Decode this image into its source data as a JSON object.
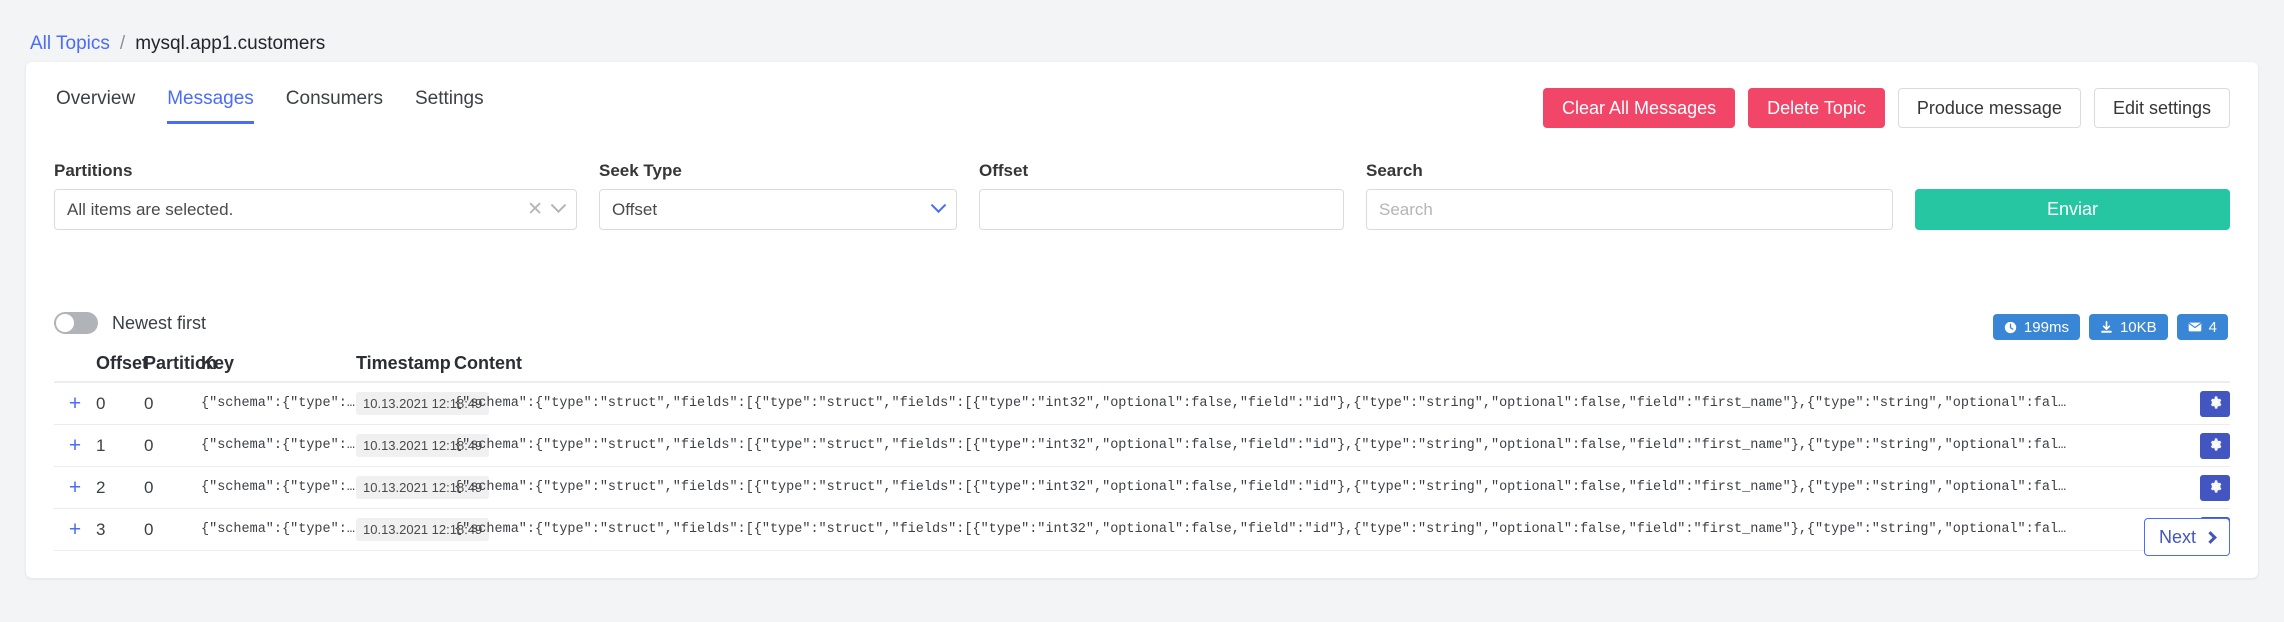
{
  "breadcrumb": {
    "root_label": "All Topics",
    "separator": "/",
    "current_label": "mysql.app1.customers"
  },
  "tabs": [
    {
      "label": "Overview",
      "active": false
    },
    {
      "label": "Messages",
      "active": true
    },
    {
      "label": "Consumers",
      "active": false
    },
    {
      "label": "Settings",
      "active": false
    }
  ],
  "actions": [
    {
      "label": "Clear All Messages",
      "style": "danger"
    },
    {
      "label": "Delete Topic",
      "style": "danger"
    },
    {
      "label": "Produce message",
      "style": "light"
    },
    {
      "label": "Edit settings",
      "style": "light"
    }
  ],
  "filters": {
    "partitions": {
      "label": "Partitions",
      "value": "All items are selected.",
      "clear_icon": "close-icon",
      "chevron_icon": "chevron-down-icon"
    },
    "seek_type": {
      "label": "Seek Type",
      "value": "Offset",
      "chevron_icon": "chevron-down-icon"
    },
    "offset": {
      "label": "Offset",
      "value": "",
      "placeholder": ""
    },
    "search": {
      "label": "Search",
      "value": "",
      "placeholder": "Search"
    },
    "submit_label": "Enviar"
  },
  "sort_toggle": {
    "label": "Newest first",
    "enabled": false
  },
  "badges": [
    {
      "icon": "clock-icon",
      "label": "199ms"
    },
    {
      "icon": "download-icon",
      "label": "10KB"
    },
    {
      "icon": "envelope-icon",
      "label": "4"
    }
  ],
  "table": {
    "columns": [
      "Offset",
      "Partition",
      "Key",
      "Timestamp",
      "Content"
    ],
    "rows": [
      {
        "expand_icon": "plus-icon",
        "offset": "0",
        "partition": "0",
        "key": "{\"schema\":{\"type\":\"struct…",
        "timestamp": "10.13.2021 12:18:49",
        "content": "{\"schema\":{\"type\":\"struct\",\"fields\":[{\"type\":\"struct\",\"fields\":[{\"type\":\"int32\",\"optional\":false,\"field\":\"id\"},{\"type\":\"string\",\"optional\":false,\"field\":\"first_name\"},{\"type\":\"string\",\"optional\":fal…",
        "action_icon": "gear-icon"
      },
      {
        "expand_icon": "plus-icon",
        "offset": "1",
        "partition": "0",
        "key": "{\"schema\":{\"type\":\"struct…",
        "timestamp": "10.13.2021 12:18:49",
        "content": "{\"schema\":{\"type\":\"struct\",\"fields\":[{\"type\":\"struct\",\"fields\":[{\"type\":\"int32\",\"optional\":false,\"field\":\"id\"},{\"type\":\"string\",\"optional\":false,\"field\":\"first_name\"},{\"type\":\"string\",\"optional\":fal…",
        "action_icon": "gear-icon"
      },
      {
        "expand_icon": "plus-icon",
        "offset": "2",
        "partition": "0",
        "key": "{\"schema\":{\"type\":\"struct…",
        "timestamp": "10.13.2021 12:18:49",
        "content": "{\"schema\":{\"type\":\"struct\",\"fields\":[{\"type\":\"struct\",\"fields\":[{\"type\":\"int32\",\"optional\":false,\"field\":\"id\"},{\"type\":\"string\",\"optional\":false,\"field\":\"first_name\"},{\"type\":\"string\",\"optional\":fal…",
        "action_icon": "gear-icon"
      },
      {
        "expand_icon": "plus-icon",
        "offset": "3",
        "partition": "0",
        "key": "{\"schema\":{\"type\":\"struct…",
        "timestamp": "10.13.2021 12:18:49",
        "content": "{\"schema\":{\"type\":\"struct\",\"fields\":[{\"type\":\"struct\",\"fields\":[{\"type\":\"int32\",\"optional\":false,\"field\":\"id\"},{\"type\":\"string\",\"optional\":false,\"field\":\"first_name\"},{\"type\":\"string\",\"optional\":fal…",
        "action_icon": "gear-icon"
      }
    ]
  },
  "pagination": {
    "next_label": "Next",
    "next_icon": "chevron-right-icon"
  },
  "colors": {
    "accent_blue": "#4a6cf7",
    "danger_red": "#f14668",
    "submit_green": "#26c6a2",
    "badge_blue": "#3a86d6",
    "gear_blue": "#4255c0"
  }
}
